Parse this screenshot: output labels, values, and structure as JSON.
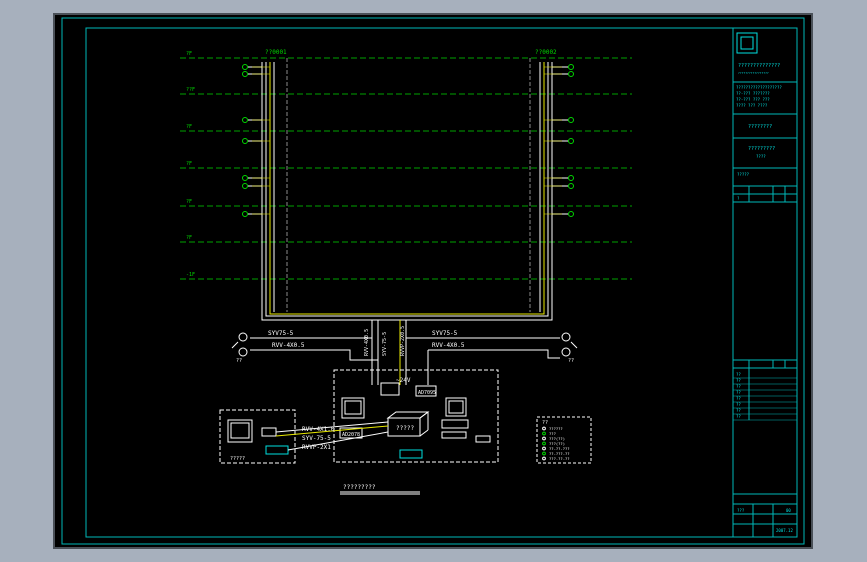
{
  "drawing": {
    "floor_labels": [
      "?F",
      "??F",
      "?F",
      "?F",
      "?F",
      "?F",
      "-1F"
    ],
    "riser_left_top": "??0001",
    "riser_right_top": "??0002",
    "cable_main_1": "SYV75-5",
    "cable_main_2": "RVV-4X0.5",
    "cable_main_1_right": "SYV75-5",
    "cable_main_2_right": "RVV-4X0.5",
    "vertical_cable_1": "RVV-4X0.5",
    "vertical_cable_2": "SYV-75-5",
    "vertical_cable_3": "RVVP-2X0.5",
    "power_label": "~24V",
    "decoder_label": "AD7095",
    "matrix_label": "?????",
    "keyboard_label": "AD2078",
    "monitor_label": "AD2078",
    "link_1": "RVV-4X1.0",
    "link_2": "SYV-75-5",
    "link_3": "RVVP-2X1",
    "remote_box_label": "?????",
    "remote_box_sub": "????",
    "legend_title": "??",
    "legend_items": [
      "??????",
      "???",
      "???(??)",
      "???(??)",
      "??-??-???",
      "??-???-??",
      "???-??-??"
    ],
    "diagram_title": "?????????",
    "camera_count_label": "?????",
    "bottom_camera_labels": [
      "??",
      "??"
    ]
  },
  "title_block": {
    "firm_name": "??????????????",
    "firm_sub": "?????????????????",
    "project_lines": [
      "???????????????????",
      "??-??? ???????",
      "??-??? ??? ???",
      "???? ??? ????"
    ],
    "project_name": "????????",
    "drawing_name": "?????????",
    "drawing_name_sub": "????",
    "block_label": "?????",
    "sheet_no": "00",
    "scale_label": "?",
    "date_label": "2007.12",
    "revision": "???",
    "sign_rows": [
      "??",
      "??",
      "??",
      "??",
      "??",
      "??",
      "??",
      "??"
    ]
  },
  "colors": {
    "green": "#00d800",
    "cyan": "#00e0e0",
    "white": "#ffffff",
    "yellow": "#e8e800",
    "gray_dash": "#8a8a8a",
    "border": "#00b8b8"
  }
}
